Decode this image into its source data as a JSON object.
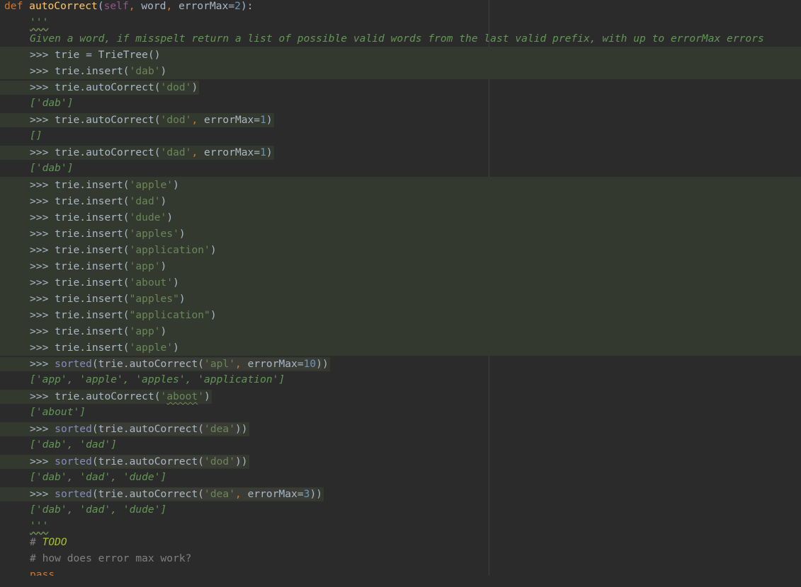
{
  "editor": {
    "def_line": {
      "kw": "def",
      "name": "autoCorrect",
      "open": "(",
      "self": "self",
      "sep1": ", ",
      "p1": "word",
      "sep2": ", ",
      "p2": "errorMax=",
      "p2val": "2",
      "close": "):"
    },
    "doc_open": "'''",
    "doc_desc": "Given a word, if misspelt return a list of possible valid words from the last valid prefix, with up to errorMax errors",
    "prompt": ">>> ",
    "l3": "trie = TrieTree()",
    "ins": "trie.insert(",
    "ac": "trie.autoCorrect(",
    "close_paren": ")",
    "comma": ", ",
    "sorted": "sorted",
    "open_paren": "(",
    "kw_errormax": "errorMax=",
    "s_dab": "'dab'",
    "s_dod": "'dod'",
    "s_dad": "'dad'",
    "s_apple": "'apple'",
    "s_dude": "'dude'",
    "s_apples": "'apples'",
    "s_application": "'application'",
    "s_app": "'app'",
    "s_about": "'about'",
    "s_apples_dq": "\"apples\"",
    "s_application_dq": "\"application\"",
    "s_apl": "'apl'",
    "s_aboot_q1": "'",
    "s_aboot_word": "aboot",
    "s_aboot_q2": "'",
    "s_dea": "'dea'",
    "n1": "1",
    "n10": "10",
    "n3": "3",
    "close2": "))",
    "out_dab": "['dab']",
    "out_empty": "[]",
    "out_apps": "['app', 'apple', 'apples', 'application']",
    "out_about": "['about']",
    "out_dab_dad": "['dab', 'dad']",
    "out_dab_dad_dude": "['dab', 'dad', 'dude']",
    "doc_close": "'''",
    "todo_hash": "# ",
    "todo_word": "TODO",
    "comment2": "# how does error max work?",
    "pass_partial": "pass"
  },
  "colors": {
    "background": "#2b2b2b",
    "keyword": "#cc7832",
    "function": "#ffc66d",
    "string": "#6a8759",
    "docstring": "#629755",
    "number": "#6897bb",
    "highlight": "#33392f"
  }
}
